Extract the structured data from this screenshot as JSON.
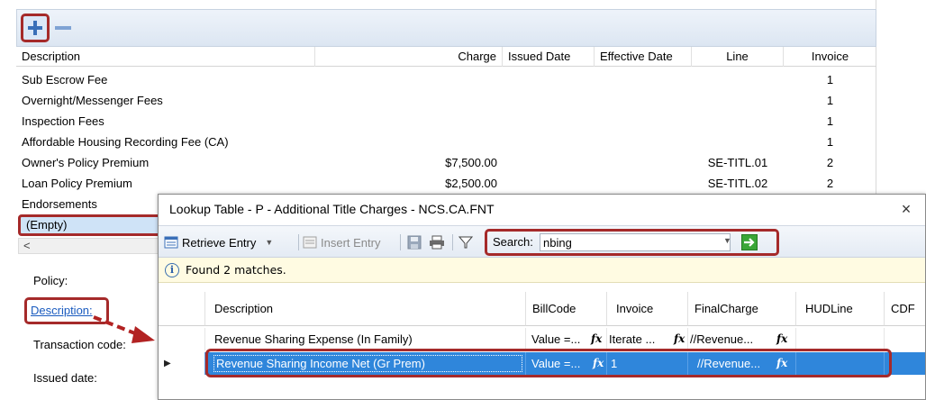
{
  "main": {
    "columns": [
      "Description",
      "Charge",
      "Issued Date",
      "Effective Date",
      "Line",
      "Invoice"
    ],
    "rows": [
      {
        "description": "Sub Escrow Fee",
        "charge": "",
        "line": "",
        "invoice": "1"
      },
      {
        "description": "Overnight/Messenger Fees",
        "charge": "",
        "line": "",
        "invoice": "1"
      },
      {
        "description": "Inspection Fees",
        "charge": "",
        "line": "",
        "invoice": "1"
      },
      {
        "description": "Affordable Housing Recording Fee (CA)",
        "charge": "",
        "line": "",
        "invoice": "1"
      },
      {
        "description": "Owner's Policy Premium",
        "charge": "$7,500.00",
        "line": "SE-TITL.01",
        "invoice": "2"
      },
      {
        "description": "Loan Policy Premium",
        "charge": "$2,500.00",
        "line": "SE-TITL.02",
        "invoice": "2"
      },
      {
        "description": "Endorsements",
        "charge": "",
        "line": "",
        "invoice": ""
      }
    ],
    "empty_row": "(Empty)",
    "scroll_arrow": "<",
    "form": {
      "policy_label": "Policy:",
      "description_link": "Description:",
      "transaction_code_label": "Transaction code:",
      "issued_date_label": "Issued date:"
    }
  },
  "dialog": {
    "title": "Lookup Table - P - Additional Title Charges - NCS.CA.FNT",
    "close": "×",
    "toolbar": {
      "retrieve_entry": "Retrieve Entry",
      "insert_entry": "Insert Entry",
      "search_label": "Search:",
      "search_value": "nbing"
    },
    "info_message": "Found 2 matches.",
    "columns": [
      "Description",
      "BillCode",
      "Invoice",
      "FinalCharge",
      "HUDLine",
      "CDF"
    ],
    "rows": [
      {
        "description": "Revenue Sharing Expense (In Family)",
        "billcode": "Value =...",
        "invoice": "Iterate ...",
        "finalcharge": "//Revenue...",
        "selected": false
      },
      {
        "description": "Revenue Sharing Income Net (Gr Prem)",
        "billcode": "Value =...",
        "invoice": "1",
        "finalcharge": "//Revenue...",
        "selected": true
      }
    ]
  },
  "colors": {
    "highlight_box": "#a52a2a",
    "selected_row": "#2f86db",
    "link": "#1a5bbf",
    "info_bar": "#fffbe2"
  },
  "icons": [
    "plus-icon",
    "minus-icon",
    "retrieve-entry-icon",
    "insert-entry-icon",
    "save-icon",
    "print-icon",
    "filter-icon",
    "go-arrow-icon",
    "info-icon",
    "row-pointer-icon",
    "formula-icon"
  ]
}
